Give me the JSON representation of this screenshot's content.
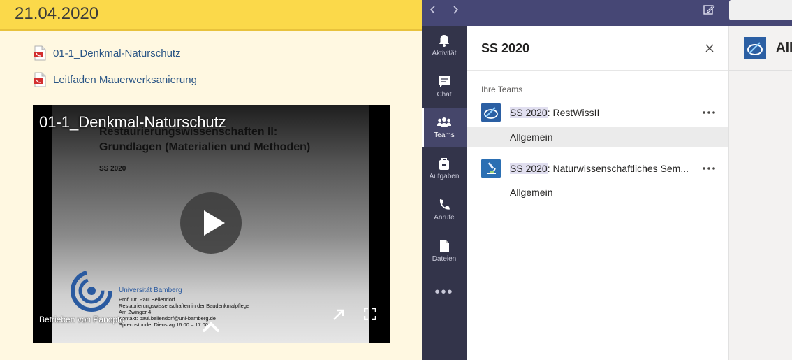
{
  "page": {
    "date": "21.04.2020",
    "files": [
      {
        "label": "01-1_Denkmal-Naturschutz",
        "icon": "pdf-icon"
      },
      {
        "label": "Leitfaden Mauerwerksanierung",
        "icon": "pdf-icon"
      }
    ],
    "video": {
      "caption": "01-1_Denkmal-Naturschutz",
      "slide_title_line1": "Restaurierungswissenschaften II:",
      "slide_title_line2": "Grundlagen (Materialien und Methoden)",
      "slide_subtitle": "SS 2020",
      "university": "Universität Bamberg",
      "info_lines": [
        "Prof. Dr. Paul Bellendorf",
        "Restaurierungswissenschaften in der Baudenkmalpflege",
        "Am Zwinger 4",
        "Kontakt: paul.bellendorf@uni-bamberg.de",
        "Sprechstunde: Dienstag 16:00 – 17:00"
      ],
      "powered_by": "Betrieben von Panopto"
    }
  },
  "teams": {
    "rail": [
      {
        "label": "Aktivität",
        "icon": "bell-icon"
      },
      {
        "label": "Chat",
        "icon": "chat-icon"
      },
      {
        "label": "Teams",
        "icon": "teams-icon",
        "active": true
      },
      {
        "label": "Aufgaben",
        "icon": "assignments-icon"
      },
      {
        "label": "Anrufe",
        "icon": "phone-icon"
      },
      {
        "label": "Dateien",
        "icon": "file-icon"
      }
    ],
    "rail_more": "•••",
    "panel": {
      "title": "SS 2020",
      "section": "Ihre Teams",
      "teams": [
        {
          "prefix": "SS 2020",
          "name": ": RestWissII",
          "channel": "Allgemein"
        },
        {
          "prefix": "SS 2020",
          "name": ": Naturwissenschaftliches Sem...",
          "channel": "Allgemein"
        }
      ]
    },
    "main_title": "All",
    "colors": {
      "top_bar": "#464775",
      "rail": "#33344a",
      "date_bar": "#fbd94a"
    }
  }
}
